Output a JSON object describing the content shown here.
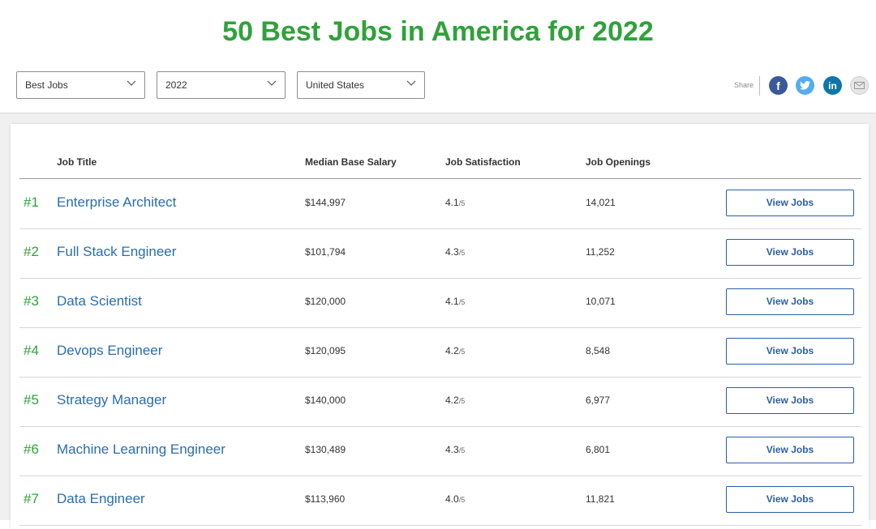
{
  "page": {
    "title": "50 Best Jobs in America for 2022"
  },
  "filters": [
    {
      "value": "Best Jobs",
      "icon": "chevron-down-icon"
    },
    {
      "value": "2022",
      "icon": "chevron-down-icon"
    },
    {
      "value": "United States",
      "icon": "chevron-down-icon"
    }
  ],
  "share": {
    "label": "Share",
    "icons": [
      {
        "name": "facebook-icon",
        "glyph": "f",
        "color": "#3b5998"
      },
      {
        "name": "twitter-icon",
        "glyph": "",
        "color": "#55acee"
      },
      {
        "name": "linkedin-icon",
        "glyph": "in",
        "color": "#0e76a8"
      },
      {
        "name": "email-icon",
        "glyph": "",
        "color": "#e6e6e6"
      }
    ]
  },
  "table": {
    "headers": {
      "title": "Job Title",
      "salary": "Median Base Salary",
      "satisfaction": "Job Satisfaction",
      "openings": "Job Openings"
    },
    "sat_suffix": "/5",
    "button_label": "View Jobs",
    "rows": [
      {
        "rank": "#1",
        "title": "Enterprise Architect",
        "salary": "$144,997",
        "satisfaction": "4.1",
        "openings": "14,021"
      },
      {
        "rank": "#2",
        "title": "Full Stack Engineer",
        "salary": "$101,794",
        "satisfaction": "4.3",
        "openings": "11,252"
      },
      {
        "rank": "#3",
        "title": "Data Scientist",
        "salary": "$120,000",
        "satisfaction": "4.1",
        "openings": "10,071"
      },
      {
        "rank": "#4",
        "title": "Devops Engineer",
        "salary": "$120,095",
        "satisfaction": "4.2",
        "openings": "8,548"
      },
      {
        "rank": "#5",
        "title": "Strategy Manager",
        "salary": "$140,000",
        "satisfaction": "4.2",
        "openings": "6,977"
      },
      {
        "rank": "#6",
        "title": "Machine Learning Engineer",
        "salary": "$130,489",
        "satisfaction": "4.3",
        "openings": "6,801"
      },
      {
        "rank": "#7",
        "title": "Data Engineer",
        "salary": "$113,960",
        "satisfaction": "4.0",
        "openings": "11,821"
      }
    ]
  }
}
